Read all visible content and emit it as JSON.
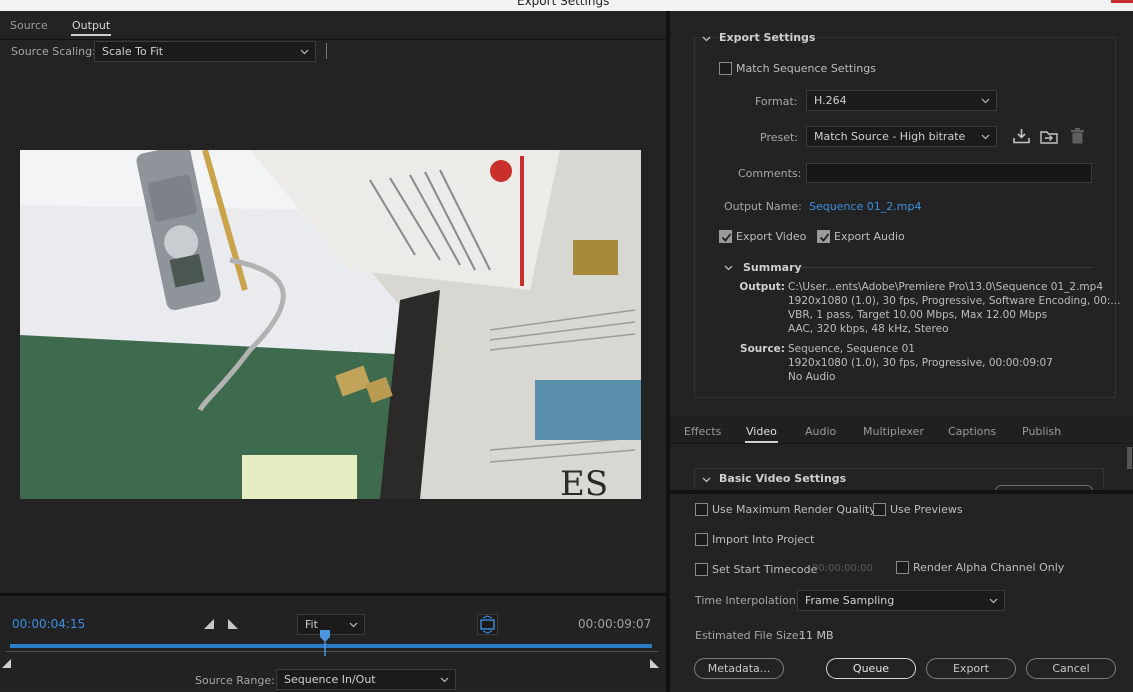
{
  "window": {
    "title": "Export Settings"
  },
  "left_tabs": [
    "Source",
    "Output"
  ],
  "source_scaling": {
    "label": "Source Scaling:",
    "value": "Scale To Fit"
  },
  "timeline": {
    "current_time": "00:00:04:15",
    "end_time": "00:00:09:07",
    "zoom": "Fit",
    "playhead_fraction": 0.49,
    "source_range_label": "Source Range:",
    "source_range_value": "Sequence In/Out"
  },
  "export": {
    "section_title": "Export Settings",
    "match_sequence_label": "Match Sequence Settings",
    "format_label": "Format:",
    "format_value": "H.264",
    "preset_label": "Preset:",
    "preset_value": "Match Source - High bitrate",
    "comments_label": "Comments:",
    "output_name_label": "Output Name:",
    "output_name_value": "Sequence 01_2.mp4",
    "export_video_label": "Export Video",
    "export_audio_label": "Export Audio"
  },
  "summary": {
    "title": "Summary",
    "output_key": "Output:",
    "output_lines": [
      "C:\\User...ents\\Adobe\\Premiere Pro\\13.0\\Sequence 01_2.mp4",
      "1920x1080 (1.0), 30 fps, Progressive, Software Encoding, 00:...",
      "VBR, 1 pass, Target 10.00 Mbps, Max 12.00 Mbps",
      "AAC, 320 kbps, 48 kHz, Stereo"
    ],
    "source_key": "Source:",
    "source_lines": [
      "Sequence, Sequence 01",
      "1920x1080 (1.0), 30 fps, Progressive, 00:00:09:07",
      "No Audio"
    ]
  },
  "right_tabs": [
    "Effects",
    "Video",
    "Audio",
    "Multiplexer",
    "Captions",
    "Publish"
  ],
  "basic_video": {
    "title": "Basic Video Settings"
  },
  "options": {
    "max_render_quality": "Use Maximum Render Quality",
    "use_previews": "Use Previews",
    "import_into_project": "Import Into Project",
    "set_start_timecode": "Set Start Timecode",
    "start_timecode_value": "00:00:00:00",
    "render_alpha": "Render Alpha Channel Only",
    "time_interp_label": "Time Interpolation:",
    "time_interp_value": "Frame Sampling",
    "file_size_label": "Estimated File Size:",
    "file_size_value": "11 MB"
  },
  "buttons": {
    "metadata": "Metadata...",
    "queue": "Queue",
    "export": "Export",
    "cancel": "Cancel"
  },
  "colors": {
    "accent_blue": "#2d7cc6",
    "link_blue": "#3d8fde",
    "background": "#232323"
  }
}
